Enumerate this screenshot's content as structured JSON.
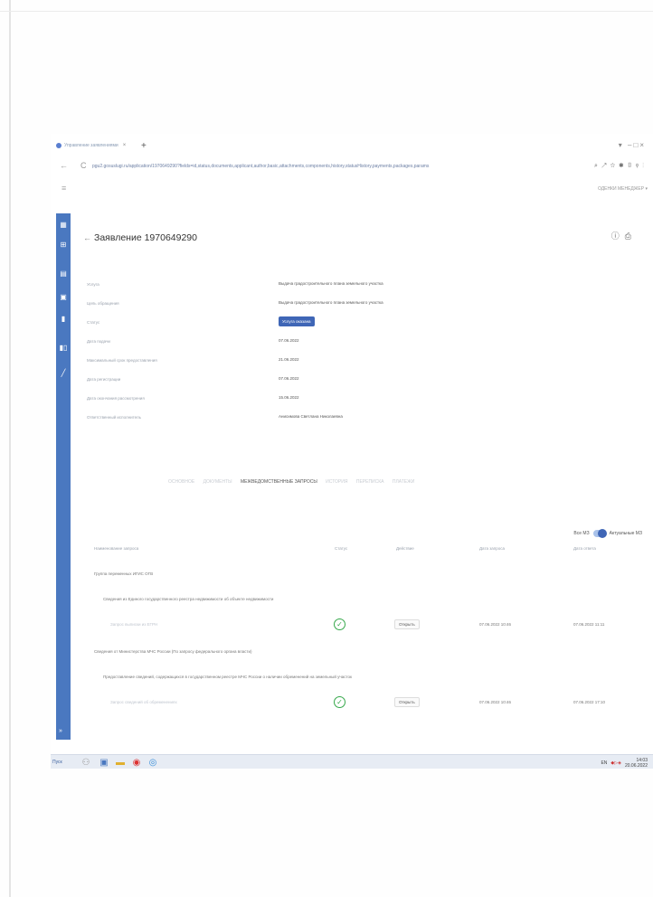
{
  "browser": {
    "tab_title": "Управление заявлениями",
    "url": "pgu2.gosuslugi.ru/application/1970649290?fields=id,status,documents,applicant,author,basic,attachments,components,history,statusHistory,payments,packages,params",
    "user_menu": "ОДЕНКИ МЕНЕДЖЕР ▾"
  },
  "page": {
    "title": "Заявление 1970649290"
  },
  "info": [
    {
      "label": "Услуга",
      "value": "Выдача градостроительного плана земельного участка"
    },
    {
      "label": "Цель обращения",
      "value": "Выдача градостроительного плана земельного участка"
    },
    {
      "label": "Статус",
      "value": "Услуга оказана",
      "badge": true
    },
    {
      "label": "Дата подачи",
      "value": "07.06.2022"
    },
    {
      "label": "Максимальный срок предоставления",
      "value": "21.06.2022"
    },
    {
      "label": "Дата регистрации",
      "value": "07.06.2022"
    },
    {
      "label": "Дата окончания рассмотрения",
      "value": "15.06.2022"
    },
    {
      "label": "Ответственный исполнитель",
      "value": "Анисимова Светлана Николаевна"
    }
  ],
  "tabs": [
    "ОСНОВНОЕ",
    "ДОКУМЕНТЫ",
    "МЕЖВЕДОМСТВЕННЫЕ ЗАПРОСЫ",
    "ИСТОРИЯ",
    "ПЕРЕПИСКА",
    "ПЛАТЕЖИ"
  ],
  "active_tab": 2,
  "toggle": {
    "left": "Все МЗ",
    "right": "Актуальные МЗ"
  },
  "table": {
    "headers": [
      "Наименование запроса",
      "Статус",
      "Действие",
      "Дата запроса",
      "Дата ответа"
    ],
    "groups": [
      {
        "title": "Группа переменных ИГИС ОГВ",
        "subtitle": "Сведения из Единого государственного реестра недвижимости об объекте недвижимости",
        "row": {
          "name": "Запрос выписки из ЕГРН",
          "action": "Открыть",
          "date_req": "07.06.2022 10:46",
          "date_resp": "07.06.2022 11:11"
        }
      },
      {
        "title": "Сведения от Министерства МЧС России (По запросу федерального органа власти)",
        "subtitle": "Предоставление сведений, содержащихся в государственном реестре МЧС России о наличии обременений на земельный участок",
        "row": {
          "name": "Запрос сведений об обременениях",
          "action": "Открыть",
          "date_req": "07.06.2022 10:46",
          "date_resp": "07.06.2022 17:10"
        }
      }
    ]
  },
  "taskbar": {
    "start": "Пуск",
    "lang": "EN",
    "time": "14:03",
    "date": "20.06.2022"
  },
  "colors": {
    "sidebar": "#4a78c0",
    "badge": "#3f66b6",
    "check": "#35a84a"
  }
}
